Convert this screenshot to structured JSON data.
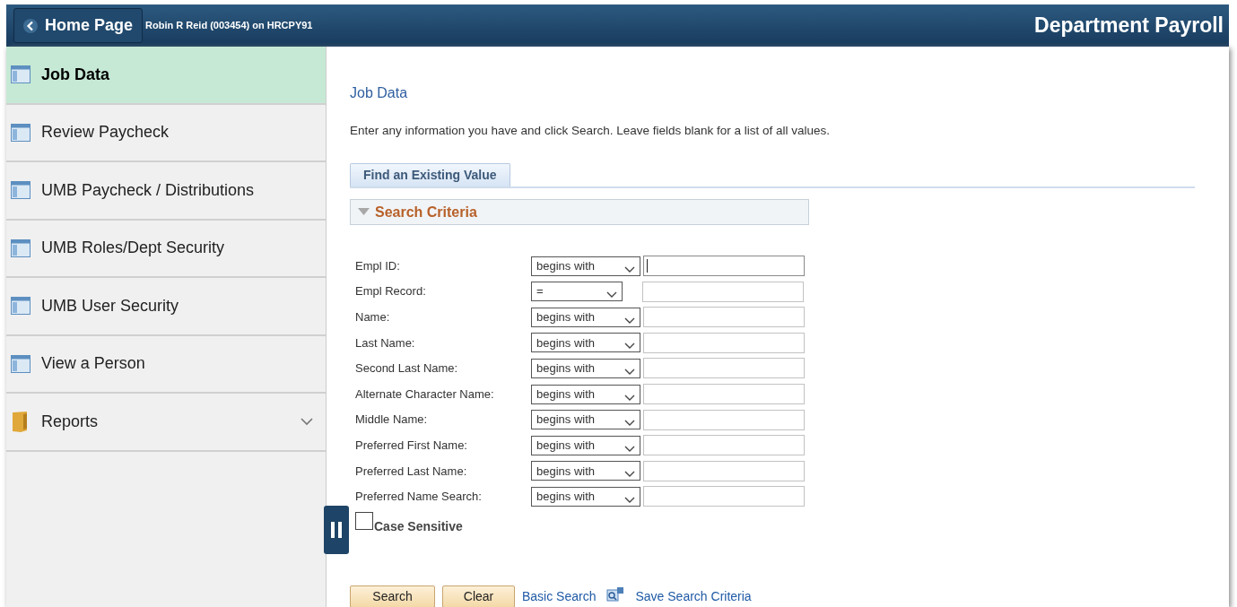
{
  "header": {
    "home_button": "Home Page",
    "user_info": "Robin R Reid (003454) on HRCPY91",
    "title": "Department Payroll"
  },
  "sidebar": {
    "items": [
      {
        "label": "Job Data",
        "kind": "page",
        "selected": true
      },
      {
        "label": "Review Paycheck",
        "kind": "page",
        "selected": false
      },
      {
        "label": "UMB Paycheck / Distributions",
        "kind": "page",
        "selected": false
      },
      {
        "label": "UMB Roles/Dept Security",
        "kind": "page",
        "selected": false
      },
      {
        "label": "UMB User Security",
        "kind": "page",
        "selected": false
      },
      {
        "label": "View a Person",
        "kind": "page",
        "selected": false
      },
      {
        "label": "Reports",
        "kind": "folder",
        "selected": false
      }
    ]
  },
  "main": {
    "title": "Job Data",
    "instructions": "Enter any information you have and click Search. Leave fields blank for a list of all values.",
    "tabs": [
      {
        "label": "Find an Existing Value",
        "selected": true
      }
    ],
    "section": {
      "title": "Search Criteria",
      "expanded": true
    },
    "fields": [
      {
        "label": "Empl ID:",
        "operator": "begins with",
        "focused": true
      },
      {
        "label": "Empl Record:",
        "operator": "=",
        "focused": false
      },
      {
        "label": "Name:",
        "operator": "begins with",
        "focused": false
      },
      {
        "label": "Last Name:",
        "operator": "begins with",
        "focused": false
      },
      {
        "label": "Second Last Name:",
        "operator": "begins with",
        "focused": false
      },
      {
        "label": "Alternate Character Name:",
        "operator": "begins with",
        "focused": false
      },
      {
        "label": "Middle Name:",
        "operator": "begins with",
        "focused": false
      },
      {
        "label": "Preferred First Name:",
        "operator": "begins with",
        "focused": false
      },
      {
        "label": "Preferred Last Name:",
        "operator": "begins with",
        "focused": false
      },
      {
        "label": "Preferred Name Search:",
        "operator": "begins with",
        "focused": false
      }
    ],
    "case_sensitive": {
      "label": "Case Sensitive",
      "checked": false
    },
    "buttons": [
      "Search",
      "Clear"
    ],
    "links": [
      "Basic Search",
      "Save Search Criteria"
    ]
  }
}
